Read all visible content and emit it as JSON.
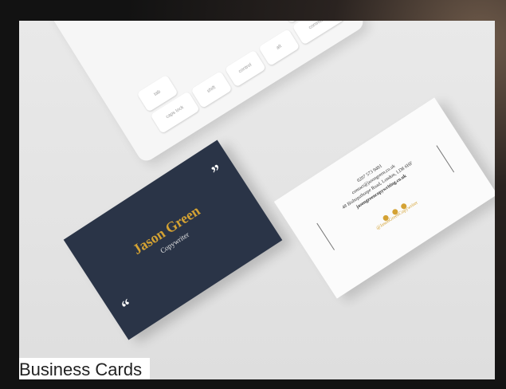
{
  "caption": "Business Cards",
  "card_front": {
    "name": "Jason Green",
    "role": "Copywriter",
    "quote_open": "“",
    "quote_close": "”"
  },
  "card_back": {
    "phone": "0207 573 9481",
    "email": "contact@jasongreen.co.uk",
    "address": "48 Bishopsthorpe Road, London, LD8 6HF",
    "website": "jasongreencopywriting.co.uk",
    "handle": "@JasonGreenCopywriter"
  },
  "keyboard_keys": [
    "tab",
    "caps lock",
    "shift",
    "control",
    "alt",
    "option",
    "command"
  ],
  "colors": {
    "navy": "#2a3447",
    "gold": "#d4a233"
  }
}
